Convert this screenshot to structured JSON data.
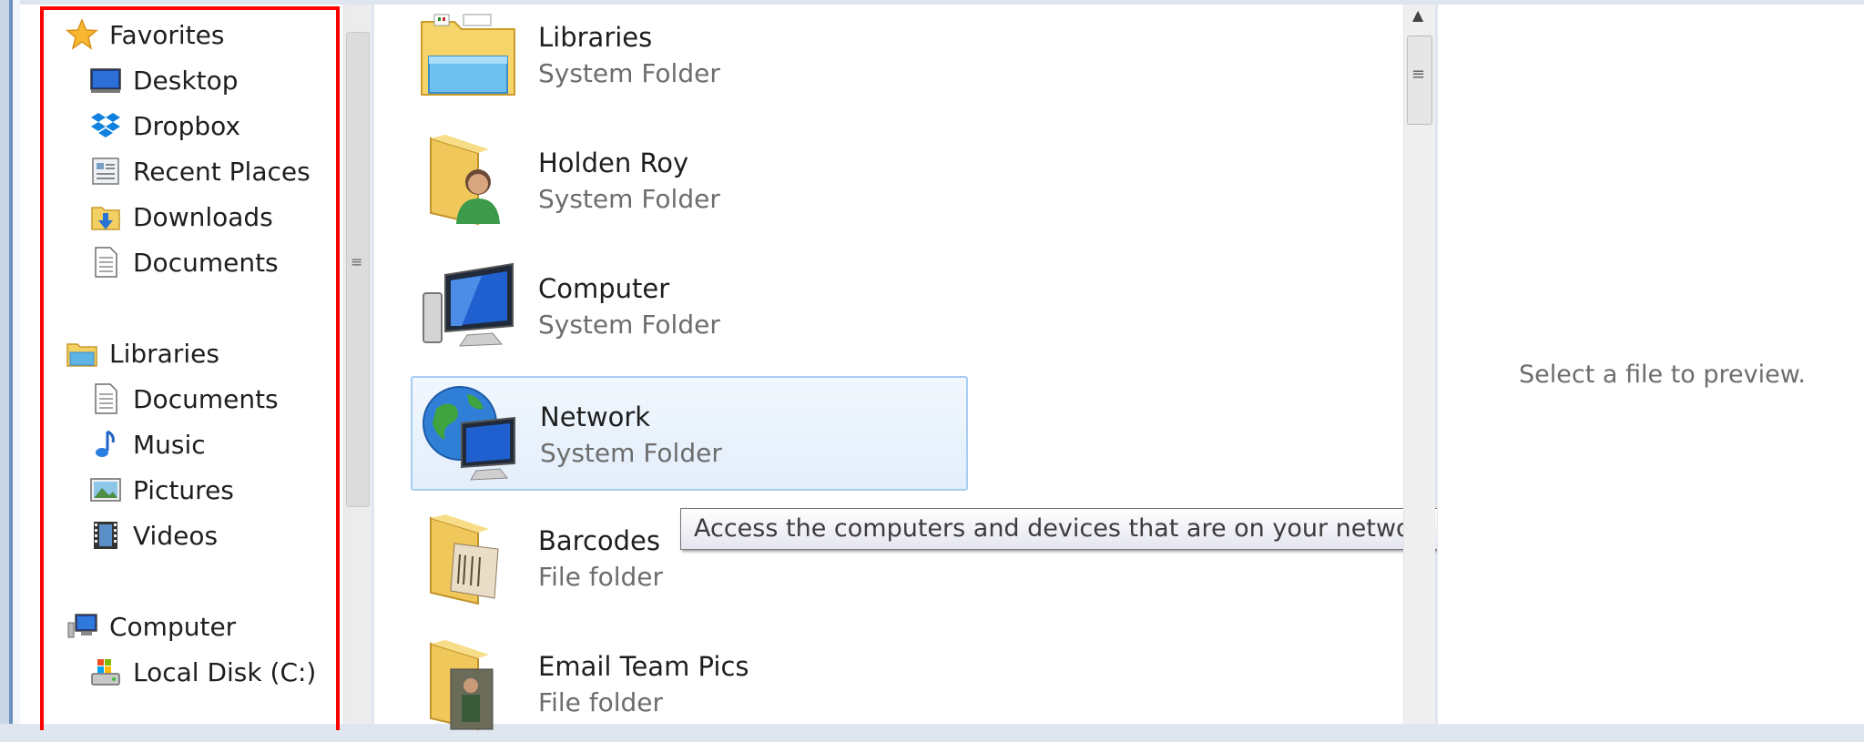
{
  "nav": {
    "favorites": {
      "label": "Favorites",
      "items": [
        {
          "label": "Desktop",
          "icon": "desktop-icon"
        },
        {
          "label": "Dropbox",
          "icon": "dropbox-icon"
        },
        {
          "label": "Recent Places",
          "icon": "recent-places-icon"
        },
        {
          "label": "Downloads",
          "icon": "downloads-icon"
        },
        {
          "label": "Documents",
          "icon": "document-icon"
        }
      ]
    },
    "libraries": {
      "label": "Libraries",
      "items": [
        {
          "label": "Documents",
          "icon": "document-icon"
        },
        {
          "label": "Music",
          "icon": "music-icon"
        },
        {
          "label": "Pictures",
          "icon": "pictures-icon"
        },
        {
          "label": "Videos",
          "icon": "videos-icon"
        }
      ]
    },
    "computer": {
      "label": "Computer",
      "items": [
        {
          "label": "Local Disk (C:)",
          "icon": "local-disk-icon"
        }
      ]
    }
  },
  "files": [
    {
      "name": "Libraries",
      "type": "System Folder",
      "icon": "libraries-folder-icon"
    },
    {
      "name": "Holden Roy",
      "type": "System Folder",
      "icon": "user-folder-icon"
    },
    {
      "name": "Computer",
      "type": "System Folder",
      "icon": "computer-icon"
    },
    {
      "name": "Network",
      "type": "System Folder",
      "icon": "network-icon",
      "selected": true
    },
    {
      "name": "Barcodes",
      "type": "File folder",
      "icon": "folder-icon"
    },
    {
      "name": "Email Team Pics",
      "type": "File folder",
      "icon": "folder-icon"
    }
  ],
  "tooltip": "Access the computers and devices that are on your network.",
  "preview": {
    "text": "Select a file to preview."
  },
  "colors": {
    "highlight_border": "#ff0000",
    "selection_border": "#a8cdf3",
    "selection_fill": "#e3eefb"
  }
}
